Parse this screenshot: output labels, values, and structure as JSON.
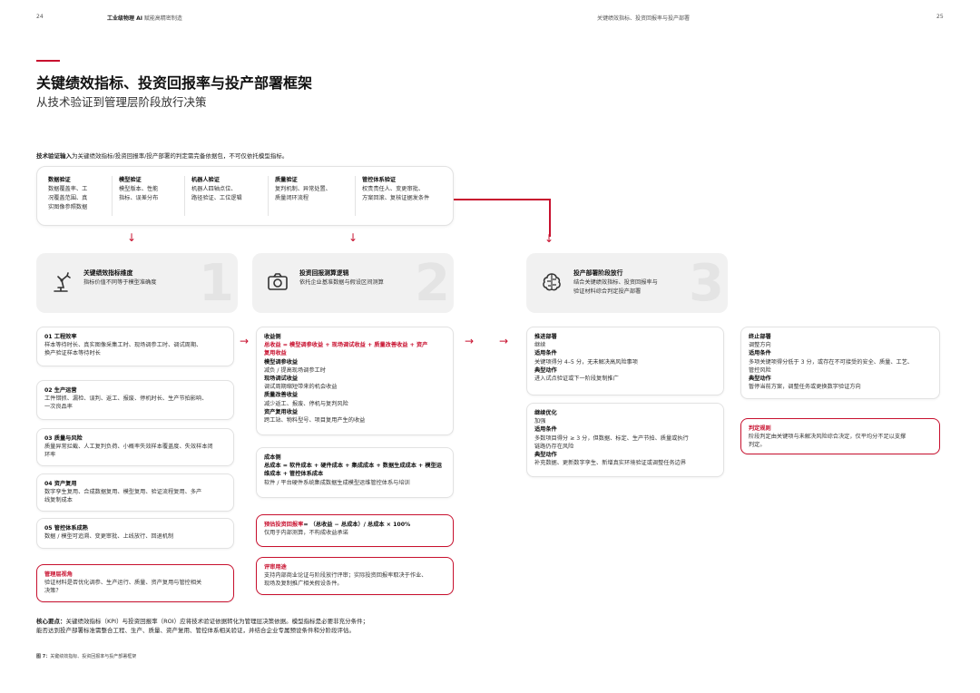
{
  "header": {
    "page_left": "24",
    "brand_bold": "工业级物理 AI",
    "brand_rest": "赋能高精密制造",
    "section": "关键绩效指标、投资回报率与投产部署",
    "page_right": "25"
  },
  "title": "关键绩效指标、投资回报率与投产部署框架",
  "subtitle": "从技术验证到管理层阶段放行决策",
  "intro": {
    "bold": "技术验证输入",
    "rest": "为关键绩效指标/投资回报率/投产部署的判定需完备依据包，不可仅依托模型指标。"
  },
  "tech_validation": [
    {
      "h": "数据验证",
      "lines": [
        "数据覆盖率、工",
        "况覆盖范围、真",
        "实图像参照数据"
      ]
    },
    {
      "h": "模型验证",
      "lines": [
        "模型版本、性能",
        "指标、误差分布"
      ]
    },
    {
      "h": "机器人验证",
      "lines": [
        "机器人四轴点位、",
        "路径验证、工位逻辑"
      ]
    },
    {
      "h": "质量验证",
      "lines": [
        "复判机制、异常处置、",
        "质量闭环流程"
      ]
    },
    {
      "h": "管控体系验证",
      "lines": [
        "权责责任人、变更审批、",
        "方案回滚、复核证据发条件"
      ]
    }
  ],
  "sections": [
    {
      "num": "1",
      "h": "关键绩效指标维度",
      "d": [
        "指标价值不同等于模型准确度"
      ],
      "icon": "robot-arm-icon"
    },
    {
      "num": "2",
      "h": "投资回报测算逻辑",
      "d": [
        "依托企业基准数据与假设区间测算"
      ],
      "icon": "camera-icon"
    },
    {
      "num": "3",
      "h": "投产部署阶段放行",
      "d": [
        "结合关键绩效指标、投资回报率与",
        "验证材料综合判定投产部署"
      ],
      "icon": "brain-icon"
    }
  ],
  "kpi": [
    {
      "h": "01 工程效率",
      "lines": [
        "样本等待时长、真实图像采集工时、现场调参工时、调试周期、",
        "换产验证样本等待时长"
      ]
    },
    {
      "h": "02 生产运营",
      "lines": [
        "工件错抓、漏检、误判、返工、报废、停机时长、生产节拍影响、",
        "一次良品率"
      ]
    },
    {
      "h": "03 质量与风险",
      "lines": [
        "质量异常拦截、人工复判负荷、小概率失效样本覆盖度、失效样本闭",
        "环率"
      ]
    },
    {
      "h": "04 资产复用",
      "lines": [
        "数字孪生复用、合成数据复用、模型复用、验证流程复用、多产",
        "线复制成本"
      ]
    },
    {
      "h": "05 管控体系成熟",
      "lines": [
        "数据 / 模型可追溯、变更审批、上线放行、回退机制"
      ]
    }
  ],
  "kpi_note": {
    "h": "管理层视角",
    "lines": [
      "验证材料是否优化调参、生产运行、质量、资产复用与管控相关",
      "决策？"
    ]
  },
  "roi_income": {
    "h": "收益侧",
    "formula": [
      "总收益 = 模型调参收益 + 现场调试收益 + 质量改善收益 + 资产",
      "复用收益"
    ],
    "items": [
      {
        "h": "模型调参收益",
        "d": "减负 / 提高现场调参工时"
      },
      {
        "h": "现场调试收益",
        "d": "调试周期缩短带来的机会收益"
      },
      {
        "h": "质量改善收益",
        "d": "减少返工、报废、停机与复判风险"
      },
      {
        "h": "资产复用收益",
        "d": "跨工站、物料型号、项目复用产生的收益"
      }
    ]
  },
  "roi_cost": {
    "h": "成本侧",
    "formula": [
      "总成本 = 软件成本 + 硬件成本 + 集成成本 + 数据生成成本 + 模型运",
      "维成本 + 管控体系成本"
    ],
    "note": "软件 / 平台硬件系统集成数据生成模型运维管控体系与培训"
  },
  "roi_formula": {
    "h": "预估投资回报率",
    "rest": "= （总收益 − 总成本）/ 总成本 × 100%",
    "note": "仅用于内部测算，不构成收益承诺"
  },
  "roi_usage": {
    "h": "评审用途",
    "lines": [
      "支持内部商业论证与阶段放行评审；实际投资回报率取决于作业、",
      "现场及复制推广相关假设条件。"
    ]
  },
  "deploy_promote": {
    "h": "推进部署",
    "sub": "继续",
    "c_h": "适用条件",
    "c": "关键项得分 4–5 分，无未解决高风险事项",
    "a_h": "典型动作",
    "a": "进入试点验证或下一阶段复制推广"
  },
  "deploy_continue": {
    "h": "继续优化",
    "sub": "加强",
    "c_h": "适用条件",
    "c": [
      "多数项目得分 ≥ 3 分，但数据、标定、生产节拍、质量或执行",
      "链路仍存在风险"
    ],
    "a_h": "典型动作",
    "a": "补充数据、更新数字孪生、新增真实环境验证或调整任务边界"
  },
  "deploy_stop": {
    "h": "终止部署",
    "sub": "调整方向",
    "c_h": "适用条件",
    "c": [
      "多项关键项得分低于 3 分，或存在不可接受的安全、质量、工艺、",
      "管控风险"
    ],
    "a_h": "典型动作",
    "a": "暂停当前方案，调整任务或更换数字验证方向"
  },
  "deploy_rule": {
    "h": "判定规则",
    "lines": [
      "阶段判定由关键项与未解决风险综合决定，仅平均分不足以支撑",
      "判定。"
    ]
  },
  "core": {
    "bold": "核心要点：",
    "line1": "关键绩效指标（KPI）与投资回报率（ROI）应将技术验证依据转化为管理层决策依据。模型指标是必要非充分条件；",
    "line2": "能否达到投产部署标准需整合工程、生产、质量、资产复用、管控体系相关验证，并结合企业专属预设条件和分阶段评估。"
  },
  "figcap": {
    "bold": "图 7：",
    "rest": "关键绩效指标、投资回报率与投产部署框架"
  },
  "colors": {
    "accent": "#c8102e",
    "card_bg": "#f1f1f1"
  }
}
